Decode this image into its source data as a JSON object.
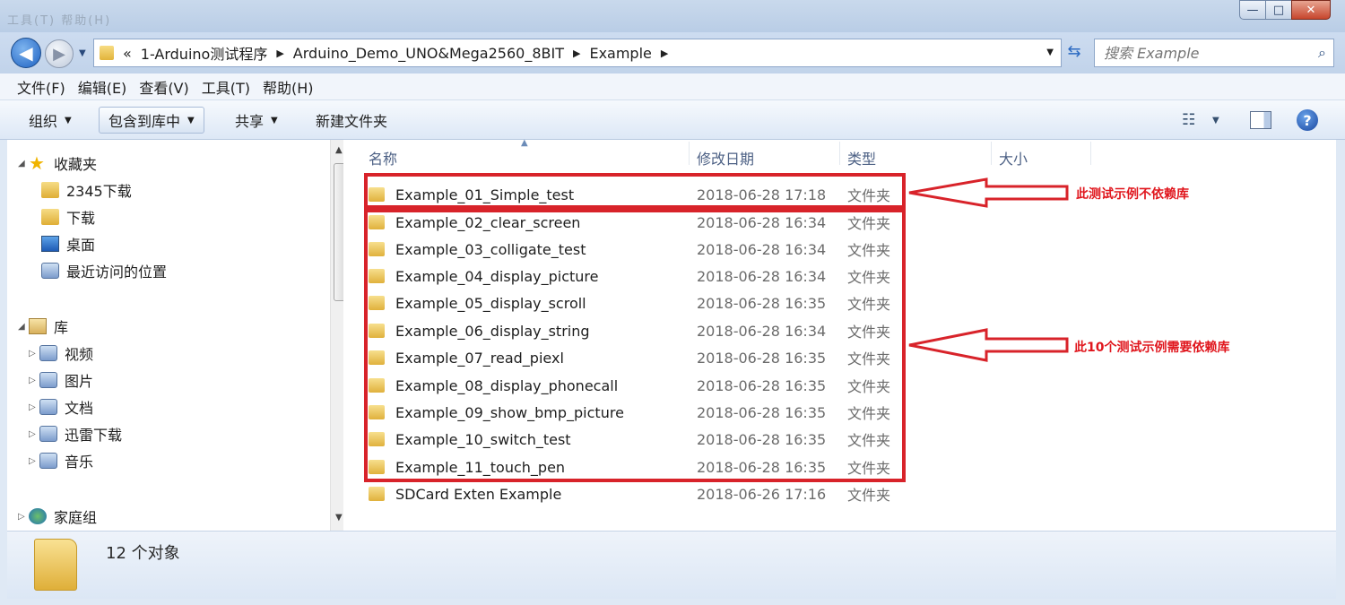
{
  "titlebar": {
    "faded_text": "工具(T)  帮助(H)"
  },
  "window_buttons": {
    "minimize": "—",
    "maximize": "□",
    "close": "✕"
  },
  "address": {
    "overflow": "«",
    "segments": [
      "1-Arduino测试程序",
      "Arduino_Demo_UNO&Mega2560_8BIT",
      "Example"
    ]
  },
  "search": {
    "placeholder": "搜索 Example"
  },
  "menu": [
    "文件(F)",
    "编辑(E)",
    "查看(V)",
    "工具(T)",
    "帮助(H)"
  ],
  "toolbar": {
    "organize": "组织",
    "include_library": "包含到库中",
    "share": "共享",
    "new_folder": "新建文件夹"
  },
  "nav": {
    "favorites": "收藏夹",
    "fav_items": [
      "2345下载",
      "下载",
      "桌面",
      "最近访问的位置"
    ],
    "libraries": "库",
    "lib_items": [
      "视频",
      "图片",
      "文档",
      "迅雷下载",
      "音乐"
    ],
    "homegroup": "家庭组"
  },
  "columns": {
    "name": "名称",
    "date": "修改日期",
    "type": "类型",
    "size": "大小"
  },
  "files": [
    {
      "name": "Example_01_Simple_test",
      "date": "2018-06-28 17:18",
      "type": "文件夹"
    },
    {
      "name": "Example_02_clear_screen",
      "date": "2018-06-28 16:34",
      "type": "文件夹"
    },
    {
      "name": "Example_03_colligate_test",
      "date": "2018-06-28 16:34",
      "type": "文件夹"
    },
    {
      "name": "Example_04_display_picture",
      "date": "2018-06-28 16:34",
      "type": "文件夹"
    },
    {
      "name": "Example_05_display_scroll",
      "date": "2018-06-28 16:35",
      "type": "文件夹"
    },
    {
      "name": "Example_06_display_string",
      "date": "2018-06-28 16:34",
      "type": "文件夹"
    },
    {
      "name": "Example_07_read_piexl",
      "date": "2018-06-28 16:35",
      "type": "文件夹"
    },
    {
      "name": "Example_08_display_phonecall",
      "date": "2018-06-28 16:35",
      "type": "文件夹"
    },
    {
      "name": "Example_09_show_bmp_picture",
      "date": "2018-06-28 16:35",
      "type": "文件夹"
    },
    {
      "name": "Example_10_switch_test",
      "date": "2018-06-28 16:35",
      "type": "文件夹"
    },
    {
      "name": "Example_11_touch_pen",
      "date": "2018-06-28 16:35",
      "type": "文件夹"
    },
    {
      "name": "SDCard Exten Example",
      "date": "2018-06-26 17:16",
      "type": "文件夹"
    }
  ],
  "annotations": {
    "note1": "此测试示例不依赖库",
    "note2": "此10个测试示例需要依赖库",
    "color": "#d8232a"
  },
  "status": {
    "count": "12 个对象"
  }
}
